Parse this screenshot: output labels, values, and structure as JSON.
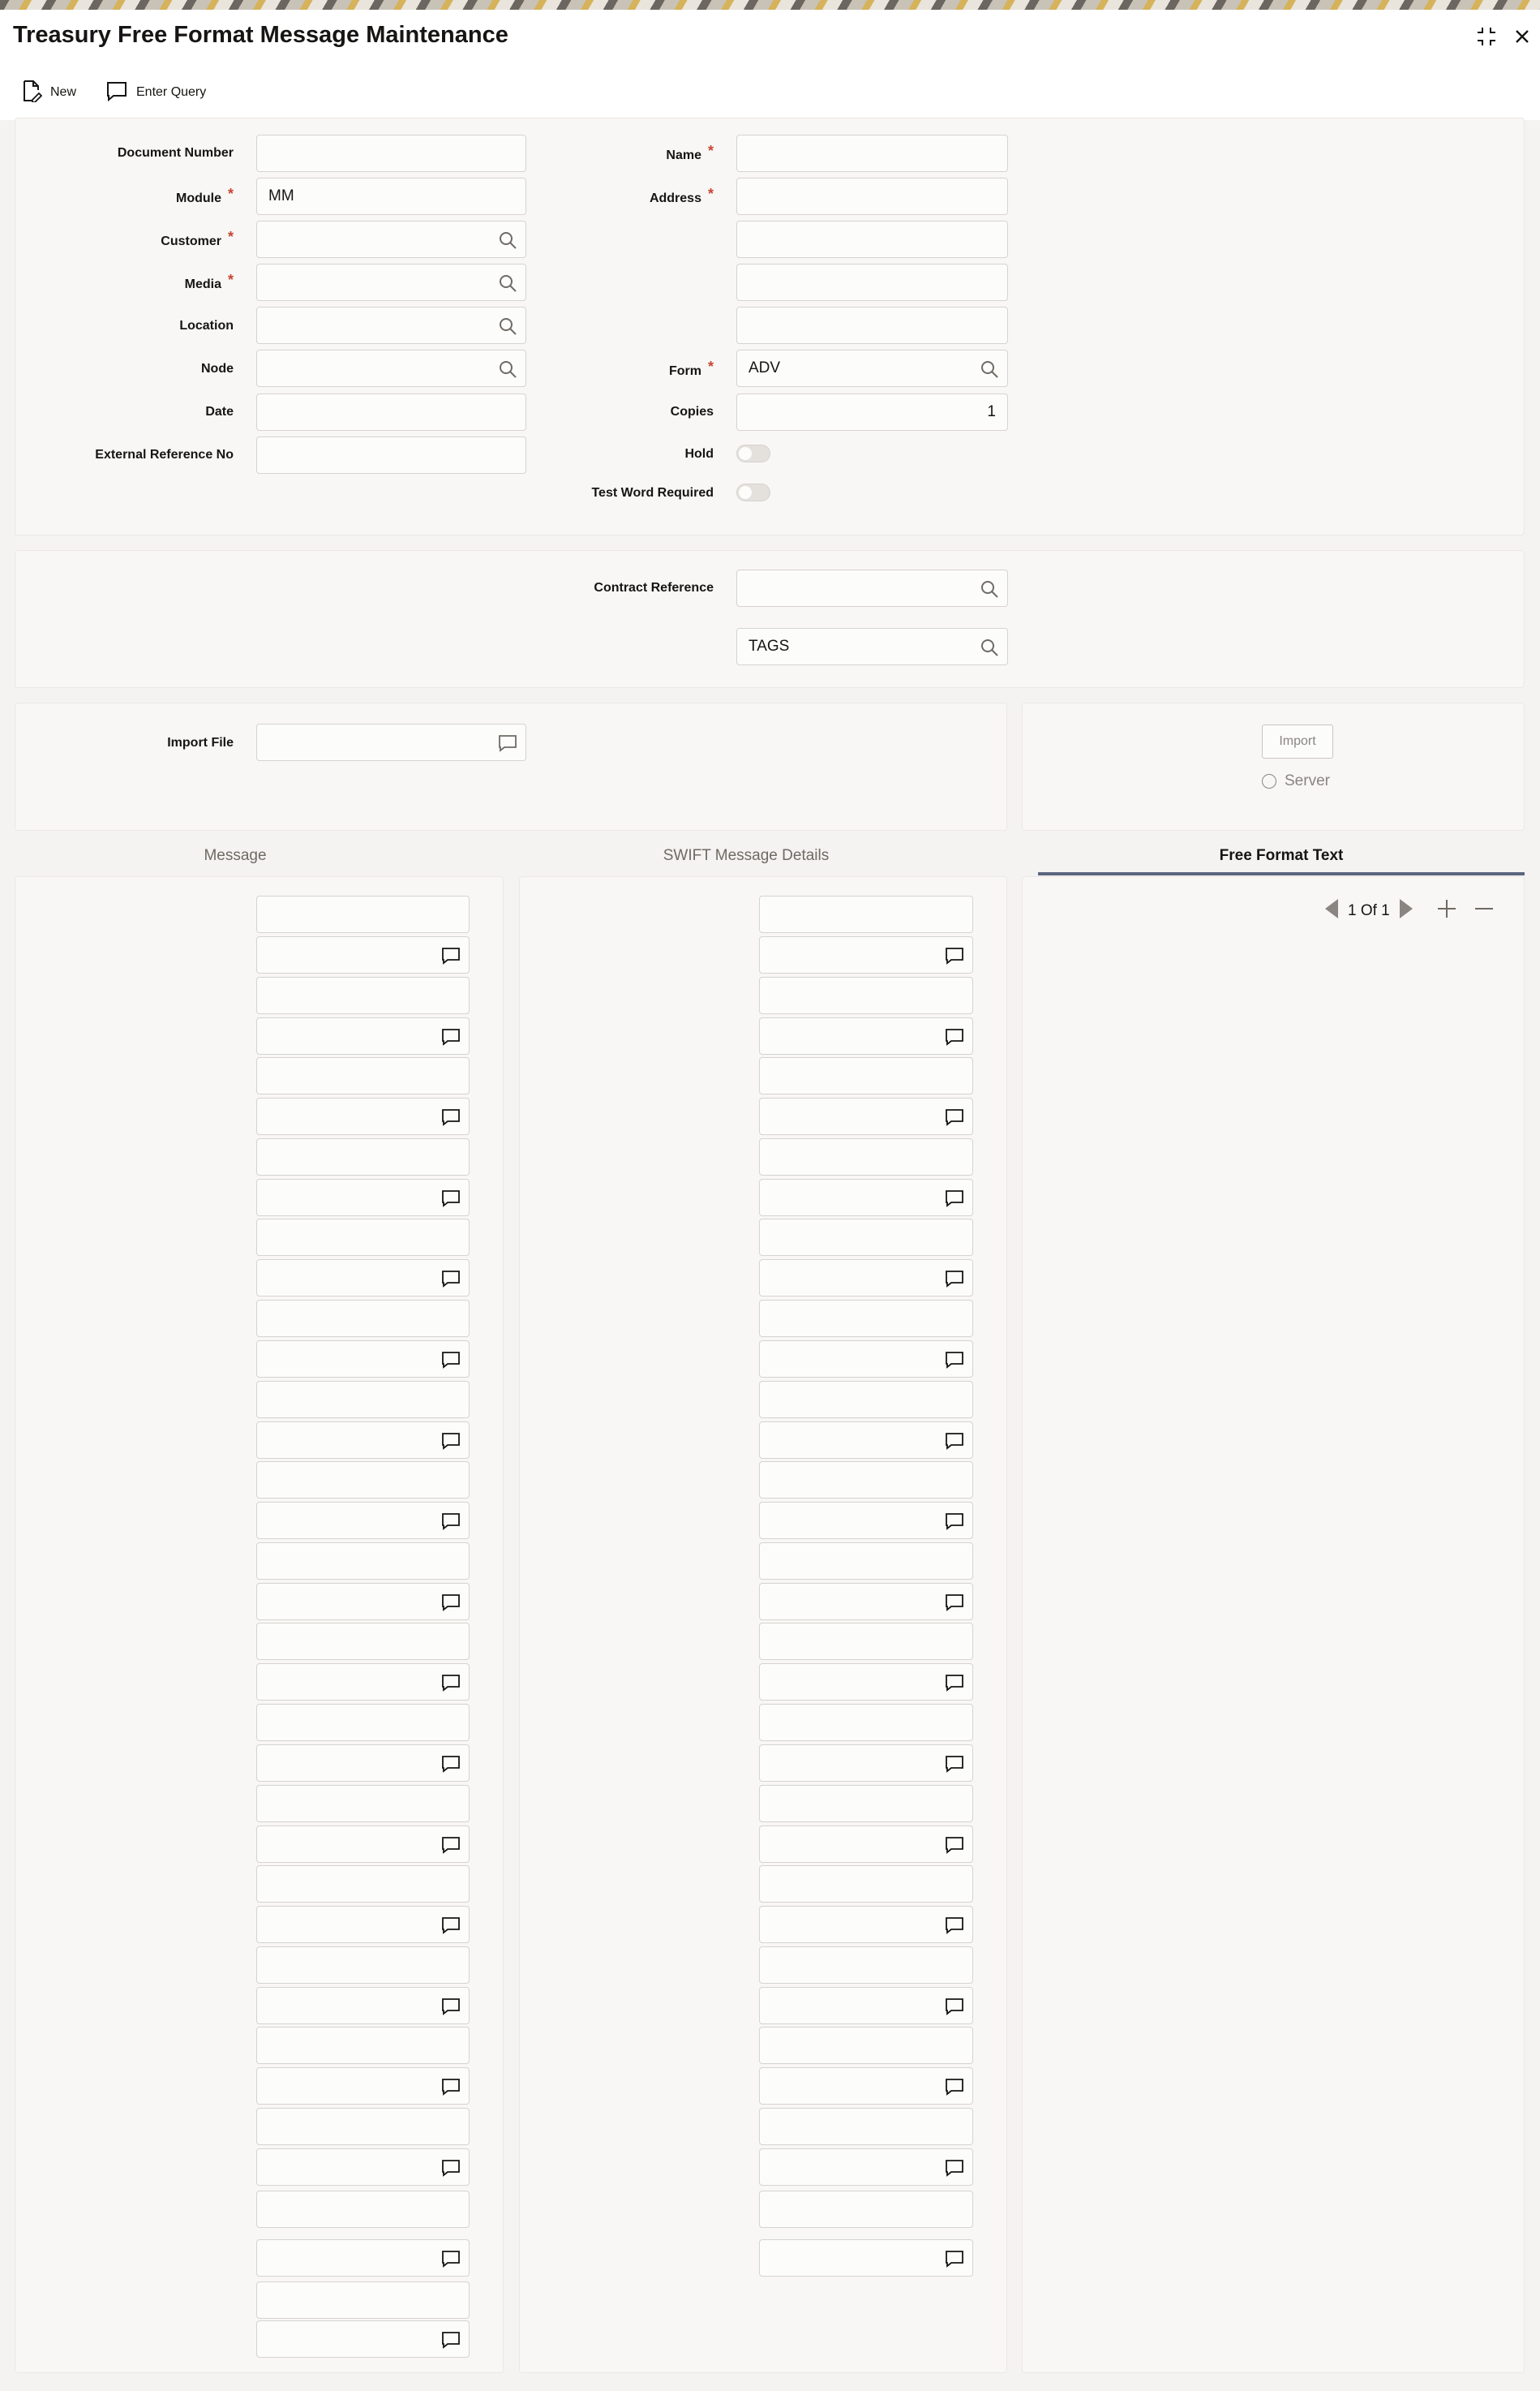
{
  "window": {
    "title": "Treasury Free Format Message Maintenance"
  },
  "toolbar": {
    "new_label": "New",
    "enter_query_label": "Enter Query"
  },
  "main_form": {
    "document_number": {
      "label": "Document Number",
      "value": ""
    },
    "module": {
      "label": "Module",
      "value": "MM",
      "required": true
    },
    "customer": {
      "label": "Customer",
      "value": "",
      "required": true
    },
    "media": {
      "label": "Media",
      "value": "",
      "required": true
    },
    "location": {
      "label": "Location",
      "value": ""
    },
    "node": {
      "label": "Node",
      "value": ""
    },
    "date": {
      "label": "Date",
      "value": ""
    },
    "external_reference_no": {
      "label": "External Reference No",
      "value": ""
    },
    "name": {
      "label": "Name",
      "value": "",
      "required": true
    },
    "address": {
      "label": "Address",
      "lines": [
        "",
        "",
        "",
        ""
      ],
      "required": true
    },
    "form": {
      "label": "Form",
      "value": "ADV",
      "required": true
    },
    "copies": {
      "label": "Copies",
      "value": "1"
    },
    "hold": {
      "label": "Hold",
      "checked": false
    },
    "test_word_required": {
      "label": "Test Word Required",
      "checked": false
    }
  },
  "contract_section": {
    "contract_reference": {
      "label": "Contract Reference",
      "value": ""
    },
    "tags": {
      "value": "TAGS"
    }
  },
  "import_section": {
    "import_file": {
      "label": "Import File",
      "value": ""
    },
    "import_button_label": "Import",
    "server_option_label": "Server"
  },
  "tabs": [
    {
      "label": "Message",
      "active": false
    },
    {
      "label": "SWIFT Message Details",
      "active": false
    },
    {
      "label": "Free Format Text",
      "active": true
    }
  ],
  "free_format_text": {
    "pager_text": "1 Of 1"
  },
  "colors": {
    "accent_underline": "#5b6580",
    "required_marker": "#c74634",
    "panel_bg": "#f8f7f5"
  },
  "icons": {
    "search": "search-icon",
    "comment": "comment-icon",
    "new_document": "new-document-icon",
    "maximize": "maximize-icon",
    "close": "close-icon"
  }
}
